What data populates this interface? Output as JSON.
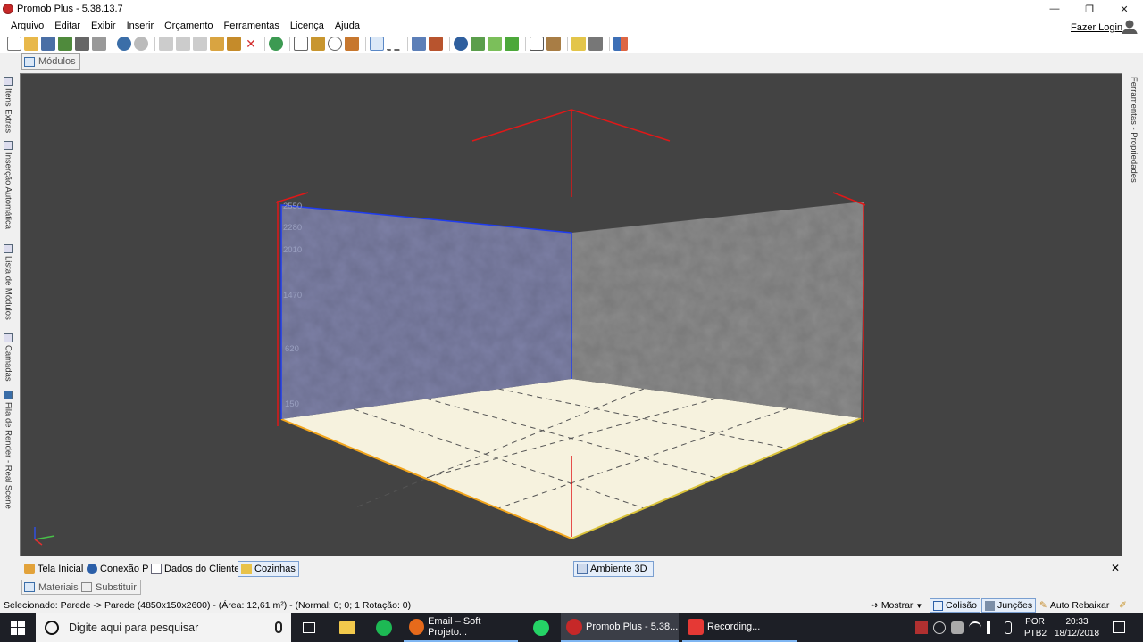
{
  "window": {
    "title": "Promob Plus - 5.38.13.7",
    "minimize_glyph": "—",
    "maximize_glyph": "❐",
    "close_glyph": "✕"
  },
  "menu": {
    "items": [
      "Arquivo",
      "Editar",
      "Exibir",
      "Inserir",
      "Orçamento",
      "Ferramentas",
      "Licença",
      "Ajuda"
    ],
    "login_label": "Fazer Login"
  },
  "modules_tab": {
    "label": "Módulos"
  },
  "left_panel": {
    "tabs": [
      "Itens Extras",
      "Inserção Automática",
      "Lista de Módulos",
      "Camadas",
      "Fila de Render - Real Scene"
    ]
  },
  "right_panel": {
    "tab": "Ferramentas - Propriedades"
  },
  "viewport": {
    "dimension_labels": [
      "2550",
      "2280",
      "2010",
      "1470",
      "620",
      "150"
    ],
    "wall_left_color": "#7d80a6",
    "wall_right_color": "#8c8c8c",
    "floor_color": "#f6f2de",
    "background_color": "#434343"
  },
  "doc_tabs": {
    "items": [
      "Tela Inicial",
      "Conexão P",
      "Dados do Cliente",
      "Cozinhas"
    ],
    "active": "Cozinhas",
    "env_tab": "Ambiente 3D",
    "close_glyph": "✕"
  },
  "sub_tabs": {
    "items": [
      "Materiais",
      "Substituir"
    ]
  },
  "status": {
    "text": "Selecionado: Parede -> Parede (4850x150x2600) - (Área: 12,61 m²) - (Normal: 0; 0; 1 Rotação: 0)",
    "show_label": "Mostrar",
    "collision_label": "Colisão",
    "junctions_label": "Junções",
    "auto_lower_label": "Auto Rebaixar"
  },
  "taskbar": {
    "search_placeholder": "Digite aqui para pesquisar",
    "apps": [
      {
        "label": "Email – Soft Projeto...",
        "color": "#e66a1b"
      },
      {
        "label": "Promob Plus - 5.38...",
        "color": "#c62828"
      },
      {
        "label": "Recording...",
        "color": "#e53935"
      }
    ],
    "language": "POR",
    "keyboard": "PTB2",
    "time": "20:33",
    "date": "18/12/2018"
  }
}
